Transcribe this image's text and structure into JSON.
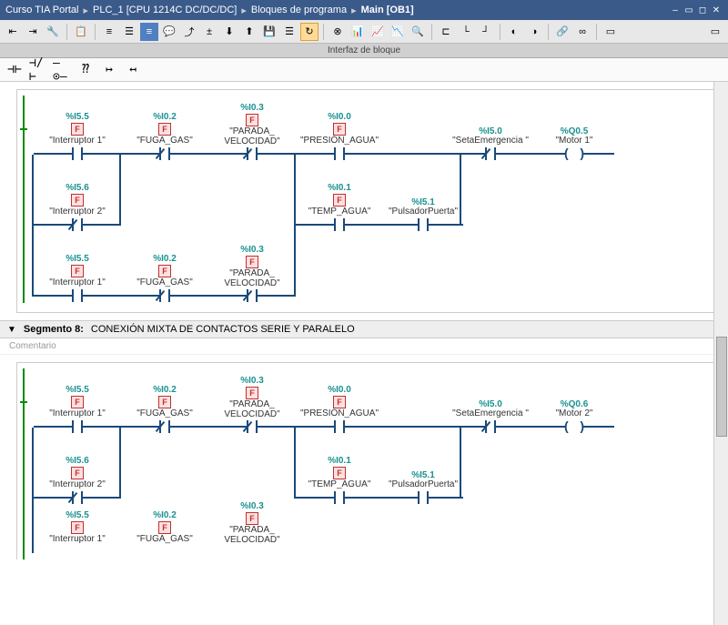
{
  "titlebar": {
    "c1": "Curso TIA Portal",
    "c2": "PLC_1 [CPU 1214C DC/DC/DC]",
    "c3": "Bloques de programa",
    "c4": "Main [OB1]",
    "sep": "▸"
  },
  "interface_label": "Interfaz de bloque",
  "segment": {
    "num": "Segmento 8:",
    "title": "CONEXIÓN MIXTA DE CONTACTOS SERIE Y PARALELO",
    "comment": "Comentario"
  },
  "net1": {
    "r1": {
      "e1": {
        "addr": "%I5.5",
        "tag": "\"Interruptor 1\""
      },
      "e2": {
        "addr": "%I0.2",
        "tag": "\"FUGA_GAS\""
      },
      "e3": {
        "addr": "%I0.3",
        "tag": "\"PARADA_ VELOCIDAD\""
      },
      "e4": {
        "addr": "%I0.0",
        "tag": "\"PRESIÓN_AGUA\""
      },
      "e5": {
        "addr": "%I5.0",
        "tag": "\"SetaEmergencia \""
      },
      "out": {
        "addr": "%Q0.5",
        "tag": "\"Motor 1\""
      }
    },
    "r2": {
      "e1": {
        "addr": "%I5.6",
        "tag": "\"Interruptor 2\""
      },
      "e4a": {
        "addr": "%I0.1",
        "tag": "\"TEMP_AGUA\""
      },
      "e4b": {
        "addr": "%I5.1",
        "tag": "\"PulsadorPuerta\""
      }
    },
    "r3": {
      "e1": {
        "addr": "%I5.5",
        "tag": "\"Interruptor 1\""
      },
      "e2": {
        "addr": "%I0.2",
        "tag": "\"FUGA_GAS\""
      },
      "e3": {
        "addr": "%I0.3",
        "tag": "\"PARADA_ VELOCIDAD\""
      }
    }
  },
  "net2": {
    "r1": {
      "e1": {
        "addr": "%I5.5",
        "tag": "\"Interruptor 1\""
      },
      "e2": {
        "addr": "%I0.2",
        "tag": "\"FUGA_GAS\""
      },
      "e3": {
        "addr": "%I0.3",
        "tag": "\"PARADA_ VELOCIDAD\""
      },
      "e4": {
        "addr": "%I0.0",
        "tag": "\"PRESIÓN_AGUA\""
      },
      "e5": {
        "addr": "%I5.0",
        "tag": "\"SetaEmergencia \""
      },
      "out": {
        "addr": "%Q0.6",
        "tag": "\"Motor 2\""
      }
    },
    "r2": {
      "e1": {
        "addr": "%I5.6",
        "tag": "\"Interruptor 2\""
      },
      "e4a": {
        "addr": "%I0.1",
        "tag": "\"TEMP_AGUA\""
      },
      "e4b": {
        "addr": "%I5.1",
        "tag": "\"PulsadorPuerta\""
      }
    },
    "r3": {
      "e1": {
        "addr": "%I5.5",
        "tag": "\"Interruptor 1\""
      },
      "e2": {
        "addr": "%I0.2",
        "tag": "\"FUGA_GAS\""
      },
      "e3": {
        "addr": "%I0.3",
        "tag": "\"PARADA_ VELOCIDAD\""
      }
    }
  },
  "fbox": "F"
}
